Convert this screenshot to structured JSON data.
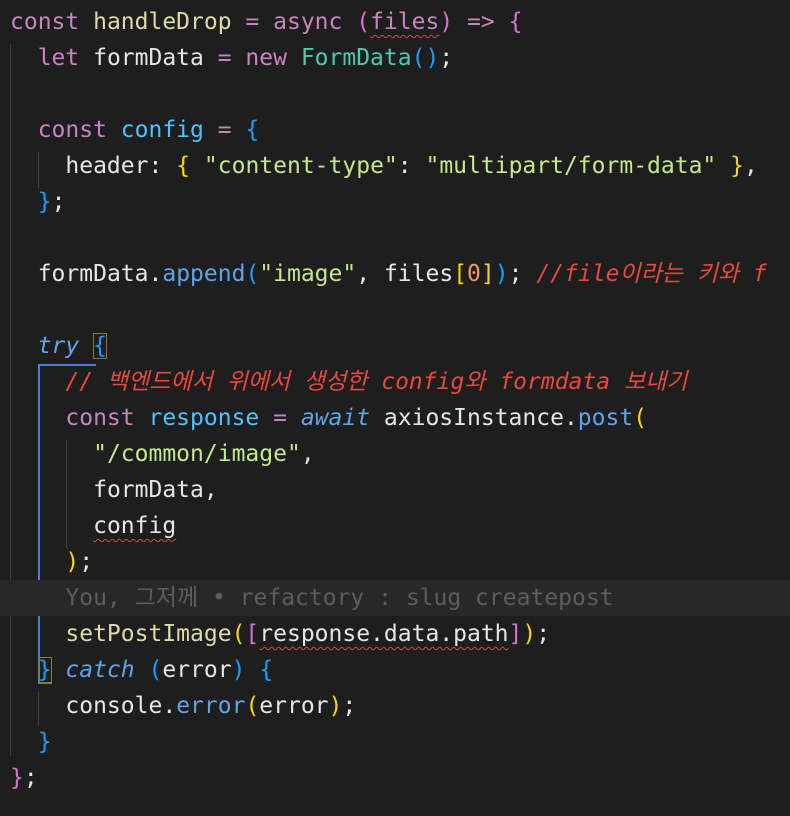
{
  "editor": {
    "language": "javascript",
    "lines": [
      [
        {
          "t": "const ",
          "c": "kw"
        },
        {
          "t": "handleDrop",
          "c": "fn"
        },
        {
          "t": " = ",
          "c": "op"
        },
        {
          "t": "async ",
          "c": "kw"
        },
        {
          "t": "(",
          "c": "b2"
        },
        {
          "t": "files",
          "c": "par",
          "sq": true
        },
        {
          "t": ")",
          "c": "b2"
        },
        {
          "t": " => ",
          "c": "op"
        },
        {
          "t": "{",
          "c": "b2"
        }
      ],
      [
        {
          "t": "  "
        },
        {
          "t": "let ",
          "c": "kw"
        },
        {
          "t": "formData",
          "c": "var"
        },
        {
          "t": " = ",
          "c": "op"
        },
        {
          "t": "new ",
          "c": "kw"
        },
        {
          "t": "FormData",
          "c": "cls"
        },
        {
          "t": "()",
          "c": "b3"
        },
        {
          "t": ";",
          "c": "pun"
        }
      ],
      [],
      [
        {
          "t": "  "
        },
        {
          "t": "const ",
          "c": "kw"
        },
        {
          "t": "config",
          "c": "cst"
        },
        {
          "t": " = ",
          "c": "op"
        },
        {
          "t": "{",
          "c": "b3"
        }
      ],
      [
        {
          "t": "    "
        },
        {
          "t": "header",
          "c": "prop"
        },
        {
          "t": ": ",
          "c": "pun"
        },
        {
          "t": "{",
          "c": "b1"
        },
        {
          "t": " "
        },
        {
          "t": "\"content-type\"",
          "c": "str"
        },
        {
          "t": ": ",
          "c": "pun"
        },
        {
          "t": "\"multipart/form-data\"",
          "c": "str"
        },
        {
          "t": " "
        },
        {
          "t": "}",
          "c": "b1"
        },
        {
          "t": ",",
          "c": "pun"
        }
      ],
      [
        {
          "t": "  "
        },
        {
          "t": "}",
          "c": "b3"
        },
        {
          "t": ";",
          "c": "pun"
        }
      ],
      [],
      [
        {
          "t": "  "
        },
        {
          "t": "formData",
          "c": "var"
        },
        {
          "t": ".",
          "c": "pun"
        },
        {
          "t": "append",
          "c": "mth"
        },
        {
          "t": "(",
          "c": "b3"
        },
        {
          "t": "\"image\"",
          "c": "str"
        },
        {
          "t": ", ",
          "c": "pun"
        },
        {
          "t": "files",
          "c": "var"
        },
        {
          "t": "[",
          "c": "b1"
        },
        {
          "t": "0",
          "c": "num"
        },
        {
          "t": "]",
          "c": "b1"
        },
        {
          "t": ")",
          "c": "b3"
        },
        {
          "t": "; ",
          "c": "pun"
        },
        {
          "t": "//file이라는 키와 f",
          "c": "cmt"
        }
      ],
      [],
      [
        {
          "t": "  "
        },
        {
          "t": "try",
          "c": "ital"
        },
        {
          "t": " "
        },
        {
          "t": "{",
          "c": "b3",
          "bm": true
        }
      ],
      [
        {
          "t": "    "
        },
        {
          "t": "// 백엔드에서 위에서 생성한 config와 formdata 보내기",
          "c": "cmt"
        }
      ],
      [
        {
          "t": "    "
        },
        {
          "t": "const ",
          "c": "kw"
        },
        {
          "t": "response",
          "c": "cst"
        },
        {
          "t": " = ",
          "c": "op"
        },
        {
          "t": "await",
          "c": "ital"
        },
        {
          "t": " "
        },
        {
          "t": "axiosInstance",
          "c": "var"
        },
        {
          "t": ".",
          "c": "pun"
        },
        {
          "t": "post",
          "c": "mth"
        },
        {
          "t": "(",
          "c": "b1"
        }
      ],
      [
        {
          "t": "      "
        },
        {
          "t": "\"/common/image\"",
          "c": "str"
        },
        {
          "t": ",",
          "c": "pun"
        }
      ],
      [
        {
          "t": "      "
        },
        {
          "t": "formData",
          "c": "var"
        },
        {
          "t": ",",
          "c": "pun"
        }
      ],
      [
        {
          "t": "      "
        },
        {
          "t": "config",
          "c": "var",
          "sq": true
        }
      ],
      [
        {
          "t": "    "
        },
        {
          "t": ")",
          "c": "b1"
        },
        {
          "t": ";",
          "c": "pun"
        }
      ],
      [
        {
          "t": "    "
        },
        {
          "t": "You, 그저께 • refactory : slug createpost",
          "c": "ghost"
        }
      ],
      [
        {
          "t": "    "
        },
        {
          "t": "setPostImage",
          "c": "fn"
        },
        {
          "t": "(",
          "c": "b1"
        },
        {
          "t": "[",
          "c": "b2"
        },
        {
          "t": "response.data.path",
          "c": "var",
          "sq": true
        },
        {
          "t": "]",
          "c": "b2"
        },
        {
          "t": ")",
          "c": "b1"
        },
        {
          "t": ";",
          "c": "pun"
        }
      ],
      [
        {
          "t": "  "
        },
        {
          "t": "}",
          "c": "b3",
          "bm": true
        },
        {
          "t": " "
        },
        {
          "t": "catch",
          "c": "ital"
        },
        {
          "t": " "
        },
        {
          "t": "(",
          "c": "b3"
        },
        {
          "t": "error",
          "c": "var"
        },
        {
          "t": ")",
          "c": "b3"
        },
        {
          "t": " "
        },
        {
          "t": "{",
          "c": "b3"
        }
      ],
      [
        {
          "t": "    "
        },
        {
          "t": "console",
          "c": "var"
        },
        {
          "t": ".",
          "c": "pun"
        },
        {
          "t": "error",
          "c": "mth"
        },
        {
          "t": "(",
          "c": "b1"
        },
        {
          "t": "error",
          "c": "var"
        },
        {
          "t": ")",
          "c": "b1"
        },
        {
          "t": ";",
          "c": "pun"
        }
      ],
      [
        {
          "t": "  "
        },
        {
          "t": "}",
          "c": "b3"
        }
      ],
      [
        {
          "t": "}",
          "c": "b2"
        },
        {
          "t": ";",
          "c": "pun"
        }
      ]
    ]
  }
}
